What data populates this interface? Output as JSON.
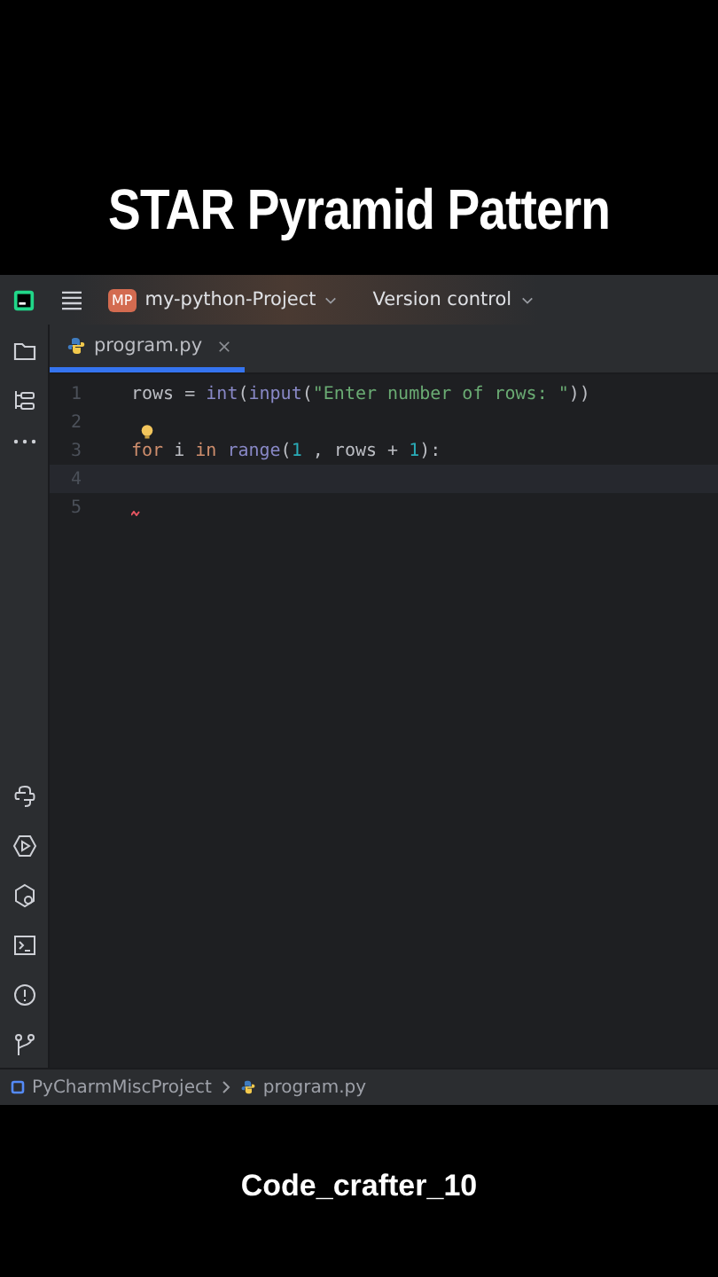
{
  "heading": "STAR Pyramid Pattern",
  "toolbar": {
    "project_badge": "MP",
    "project": "my-python-Project",
    "vcs": "Version control"
  },
  "tabs": [
    {
      "label": "program.py",
      "selected": true
    }
  ],
  "code": [
    {
      "number": "1",
      "current": false,
      "error": false,
      "hint": false,
      "tokens": [
        {
          "text": "rows = ",
          "kind": "plain"
        },
        {
          "text": "int",
          "kind": "builtin"
        },
        {
          "text": "(",
          "kind": "plain"
        },
        {
          "text": "input",
          "kind": "builtin"
        },
        {
          "text": "(",
          "kind": "plain"
        },
        {
          "text": "\"Enter number of rows: \"",
          "kind": "string"
        },
        {
          "text": "))",
          "kind": "plain"
        }
      ]
    },
    {
      "number": "2",
      "current": false,
      "error": false,
      "hint": false
    },
    {
      "number": "3",
      "current": false,
      "error": false,
      "hint": true,
      "tokens": [
        {
          "text": "for",
          "kind": "keyword"
        },
        {
          "text": " i ",
          "kind": "plain"
        },
        {
          "text": "in",
          "kind": "keyword"
        },
        {
          "text": " range",
          "kind": "builtin"
        },
        {
          "text": "(",
          "kind": "plain"
        },
        {
          "text": "1",
          "kind": "number"
        },
        {
          "text": " , rows + ",
          "kind": "plain"
        },
        {
          "text": "1",
          "kind": "number"
        },
        {
          "text": "):",
          "kind": "plain"
        }
      ]
    },
    {
      "number": "4",
      "current": true,
      "error": false,
      "hint": false
    },
    {
      "number": "5",
      "current": false,
      "error": true,
      "hint": false
    }
  ],
  "breadcrumbs": [
    {
      "label": "PyCharmMiscProject",
      "kind": "project"
    },
    {
      "label": "program.py",
      "kind": "file"
    }
  ],
  "credit": "Code_crafter_10"
}
